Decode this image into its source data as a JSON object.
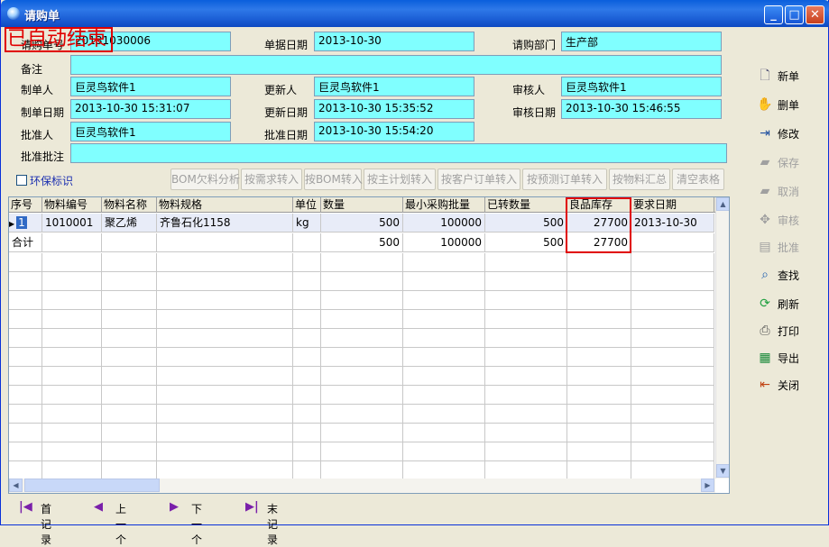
{
  "window": {
    "title": "请购单"
  },
  "stamp": "已自动结束",
  "form": {
    "doc_no_label": "请购单号",
    "doc_no": "20131030006",
    "doc_date_label": "单据日期",
    "doc_date": "2013-10-30",
    "dept_label": "请购部门",
    "dept": "生产部",
    "remark_label": "备注",
    "remark": "",
    "creator_label": "制单人",
    "creator": "巨灵鸟软件1",
    "updater_label": "更新人",
    "updater": "巨灵鸟软件1",
    "auditor_label": "审核人",
    "auditor": "巨灵鸟软件1",
    "create_date_label": "制单日期",
    "create_date": "2013-10-30 15:31:07",
    "update_date_label": "更新日期",
    "update_date": "2013-10-30 15:35:52",
    "audit_date_label": "审核日期",
    "audit_date": "2013-10-30 15:46:55",
    "approver_label": "批准人",
    "approver": "巨灵鸟软件1",
    "approve_date_label": "批准日期",
    "approve_date": "2013-10-30 15:54:20",
    "approve_note_label": "批准批注",
    "approve_note": ""
  },
  "eco_label": "环保标识",
  "grid_buttons": [
    "BOM欠料分析",
    "按需求转入",
    "按BOM转入",
    "按主计划转入",
    "按客户订单转入",
    "按预测订单转入",
    "按物料汇总",
    "清空表格"
  ],
  "columns": [
    "序号",
    "物料编号",
    "物料名称",
    "物料规格",
    "单位",
    "数量",
    "最小采购批量",
    "已转数量",
    "良品库存",
    "要求日期"
  ],
  "rows": [
    {
      "seq": "1",
      "code": "1010001",
      "name": "聚乙烯",
      "spec": "齐鲁石化1158",
      "unit": "kg",
      "qty": "500",
      "min_lot": "100000",
      "converted": "500",
      "stock": "27700",
      "req_date": "2013-10-30"
    }
  ],
  "total": {
    "label": "合计",
    "qty": "500",
    "min_lot": "100000",
    "converted": "500",
    "stock": "27700"
  },
  "sidebar": {
    "new": "新单",
    "delete": "删单",
    "edit": "修改",
    "save": "保存",
    "cancel": "取消",
    "audit": "审核",
    "approve": "批准",
    "find": "查找",
    "refresh": "刷新",
    "print": "打印",
    "export": "导出",
    "close": "关闭"
  },
  "nav": {
    "first": "首记录",
    "prev": "上一个",
    "next": "下一个",
    "last": "末记录"
  }
}
